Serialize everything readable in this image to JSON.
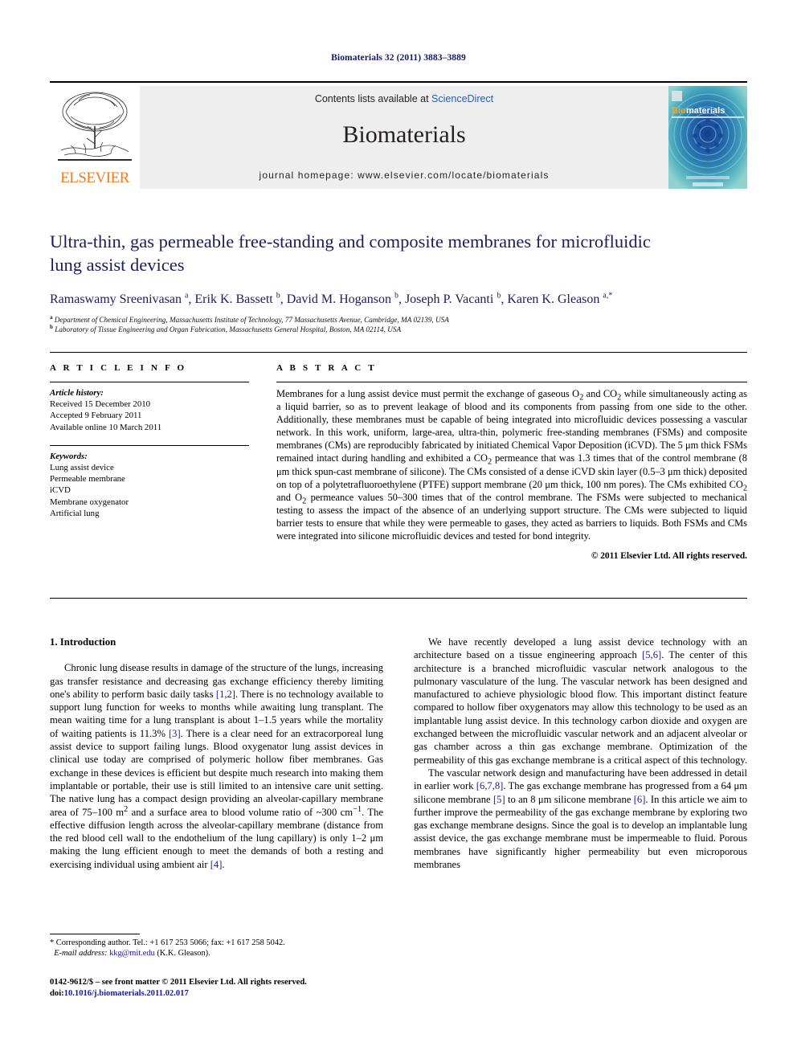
{
  "running_head": "Biomaterials 32 (2011) 3883–3889",
  "masthead": {
    "publisher": "ELSEVIER",
    "contents_prefix": "Contents lists available at",
    "contents_link": "ScienceDirect",
    "journal_name": "Biomaterials",
    "homepage": "journal homepage: www.elsevier.com/locate/biomaterials",
    "cover_title_a": "Bio",
    "cover_title_b": "materials"
  },
  "article": {
    "title": "Ultra-thin, gas permeable free-standing and composite membranes for microfluidic lung assist devices",
    "authors_html": "Ramaswamy Sreenivasan <sup>a</sup>, Erik K. Bassett <sup>b</sup>, David M. Hoganson <sup>b</sup>, Joseph P. Vacanti <sup>b</sup>, Karen K. Gleason <sup>a,</sup><sup>*</sup>",
    "affiliation_a": "Department of Chemical Engineering, Massachusetts Institute of Technology, 77 Massachusetts Avenue, Cambridge, MA 02139, USA",
    "affiliation_b": "Laboratory of Tissue Engineering and Organ Fabrication, Massachusetts General Hospital, Boston, MA 02114, USA"
  },
  "info": {
    "heading": "A R T I C L E   I N F O",
    "history_label": "Article history:",
    "history": [
      "Received 15 December 2010",
      "Accepted 9 February 2011",
      "Available online 10 March 2011"
    ],
    "keywords_label": "Keywords:",
    "keywords": [
      "Lung assist device",
      "Permeable membrane",
      "iCVD",
      "Membrane oxygenator",
      "Artificial lung"
    ]
  },
  "abstract": {
    "heading": "A B S T R A C T",
    "text": "Membranes for a lung assist device must permit the exchange of gaseous O2 and CO2 while simultaneously acting as a liquid barrier, so as to prevent leakage of blood and its components from passing from one side to the other. Additionally, these membranes must be capable of being integrated into microfluidic devices possessing a vascular network. In this work, uniform, large-area, ultra-thin, polymeric free-standing membranes (FSMs) and composite membranes (CMs) are reproducibly fabricated by initiated Chemical Vapor Deposition (iCVD). The 5 μm thick FSMs remained intact during handling and exhibited a CO2 permeance that was 1.3 times that of the control membrane (8 μm thick spun-cast membrane of silicone). The CMs consisted of a dense iCVD skin layer (0.5–3 μm thick) deposited on top of a polytetrafluoroethylene (PTFE) support membrane (20 μm thick, 100 nm pores). The CMs exhibited CO2 and O2 permeance values 50–300 times that of the control membrane. The FSMs were subjected to mechanical testing to assess the impact of the absence of an underlying support structure. The CMs were subjected to liquid barrier tests to ensure that while they were permeable to gases, they acted as barriers to liquids. Both FSMs and CMs were integrated into silicone microfluidic devices and tested for bond integrity.",
    "copyright": "© 2011 Elsevier Ltd. All rights reserved."
  },
  "introduction": {
    "section_title": "1. Introduction",
    "para1_a": "Chronic lung disease results in damage of the structure of the lungs, increasing gas transfer resistance and decreasing gas exchange efficiency thereby limiting one's ability to perform basic daily tasks ",
    "ref_12": "[1,2]",
    "para1_b": ". There is no technology available to support lung function for weeks to months while awaiting lung transplant. The mean waiting time for a lung transplant is about 1–1.5 years while the mortality of waiting patients is 11.3% ",
    "ref_3": "[3]",
    "para1_c": ". There is a clear need for an extracorporeal lung assist device to support failing lungs. Blood oxygenator lung assist devices in clinical use today are comprised of polymeric hollow fiber membranes. Gas exchange in these devices is efficient but despite much research into making them implantable or portable, their use is still limited to an intensive care unit setting. The native lung has a compact design providing an alveolar-capillary membrane area of 75–100 m2 and a surface area to blood volume ratio of ~300 cm−1. The effective diffusion length across the alveolar-capillary membrane (distance from the red blood cell wall to the endothelium of the lung capillary) is only 1–2 μm making the lung efficient enough to meet the demands of both a resting and exercising individual using ambient air ",
    "ref_4": "[4]",
    "para1_d": ".",
    "para2_a": "We have recently developed a lung assist device technology with an architecture based on a tissue engineering approach ",
    "ref_56": "[5,6]",
    "para2_b": ". The center of this architecture is a branched microfluidic vascular network analogous to the pulmonary vasculature of the lung. The vascular network has been designed and manufactured to achieve physiologic blood flow. This important distinct feature compared to hollow fiber oxygenators may allow this technology to be used as an implantable lung assist device. In this technology carbon dioxide and oxygen are exchanged between the microfluidic vascular network and an adjacent alveolar or gas chamber across a thin gas exchange membrane. Optimization of the permeability of this gas exchange membrane is a critical aspect of this technology.",
    "para3_a": "The vascular network design and manufacturing have been addressed in detail in earlier work ",
    "ref_678": "[6,7,8]",
    "para3_b": ". The gas exchange membrane has progressed from a 64 μm silicone membrane ",
    "ref_5": "[5]",
    "para3_c": " to an 8 μm silicone membrane ",
    "ref_6": "[6]",
    "para3_d": ". In this article we aim to further improve the permeability of the gas exchange membrane by exploring two gas exchange membrane designs. Since the goal is to develop an implantable lung assist device, the gas exchange membrane must be impermeable to fluid. Porous membranes have significantly higher permeability but even microporous membranes"
  },
  "footnote": {
    "corresponding": "* Corresponding author. Tel.: +1 617 253 5066; fax: +1 617 258 5042.",
    "email_label": "E-mail address:",
    "email": "kkg@mit.edu",
    "email_owner": "(K.K. Gleason)."
  },
  "imprint": {
    "line1": "0142-9612/$ – see front matter © 2011 Elsevier Ltd. All rights reserved.",
    "doi_label": "doi:",
    "doi": "10.1016/j.biomaterials.2011.02.017"
  },
  "colors": {
    "title_navy": "#1c1c5a",
    "link_blue": "#2b5faa",
    "ref_blue": "#1c1c8c",
    "elsevier_orange": "#ef7d23",
    "band_gray": "#eeeeee"
  }
}
